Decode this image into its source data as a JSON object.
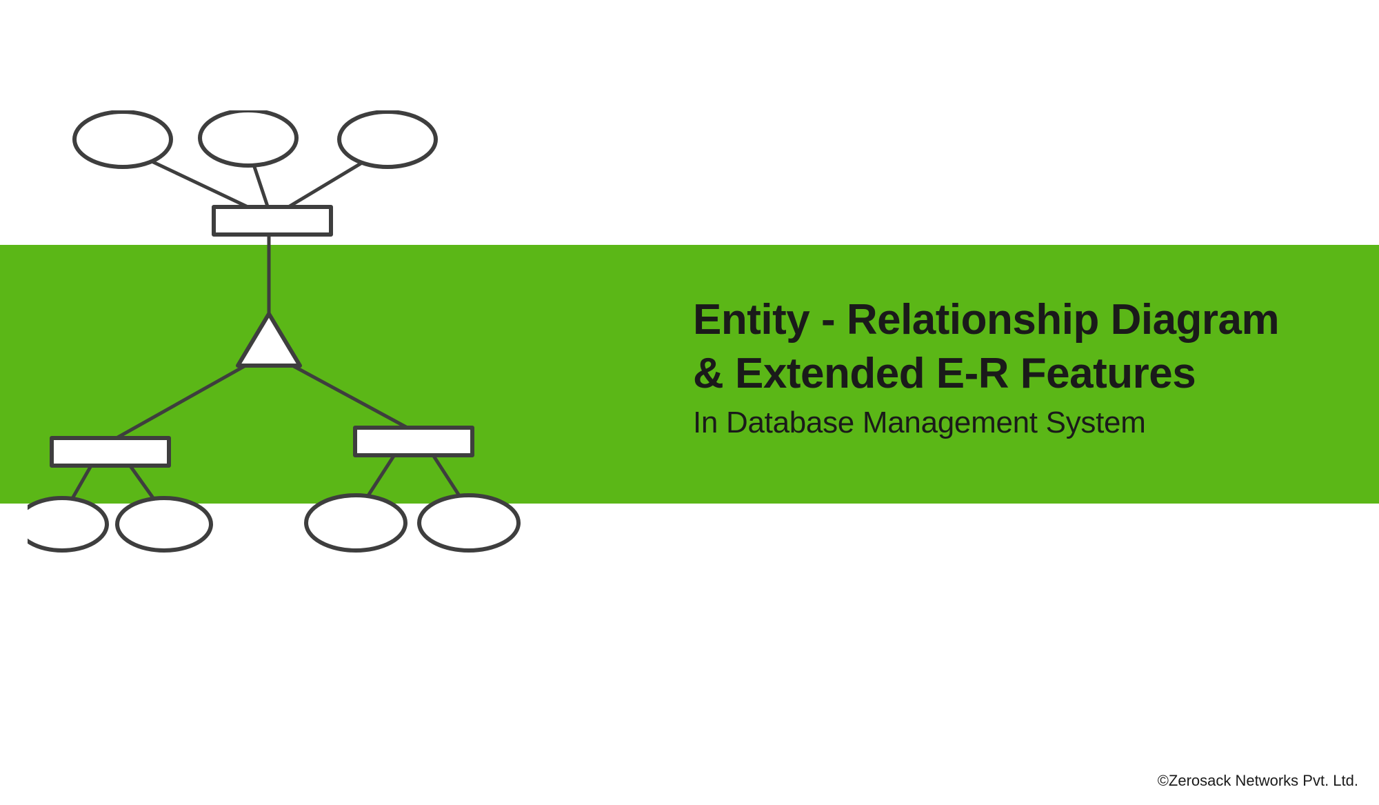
{
  "title_line1": "Entity - Relationship Diagram",
  "title_line2": "& Extended E-R Features",
  "subtitle": "In Database Management System",
  "copyright": "©Zerosack Networks Pvt. Ltd.",
  "colors": {
    "band": "#5bb717",
    "stroke": "#3e3e3e",
    "text": "#1a1a1a"
  },
  "diagram": {
    "type": "er-generalization",
    "description": "ER diagram showing a super-entity (rectangle) connected to three attribute ellipses above, a triangle (ISA / specialization) below, branching to two sub-entities (rectangles), each with two attribute ellipses.",
    "nodes": {
      "top_attrs": 3,
      "super_entity": 1,
      "isa_triangle": 1,
      "sub_entities": 2,
      "bottom_attrs_per_entity": 2
    }
  }
}
